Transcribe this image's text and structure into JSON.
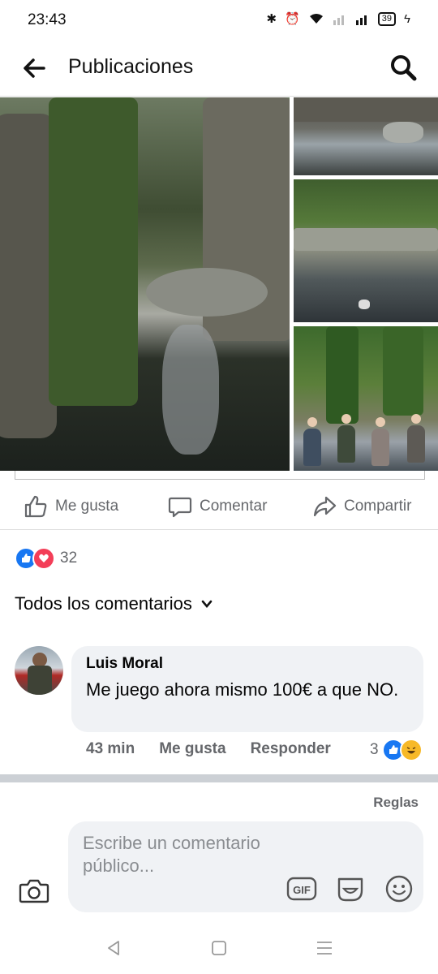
{
  "status_bar": {
    "time": "23:43",
    "battery": "39"
  },
  "header": {
    "title": "Publicaciones"
  },
  "actions": {
    "like": "Me gusta",
    "comment": "Comentar",
    "share": "Compartir"
  },
  "reactions": {
    "count": "32",
    "types": [
      "like-icon",
      "love-icon"
    ]
  },
  "comments_filter": {
    "label": "Todos los comentarios"
  },
  "comment": {
    "author": "Luis Moral",
    "text": "Me juego ahora mismo 100€ a que NO.",
    "time": "43 min",
    "like": "Me gusta",
    "reply": "Responder",
    "reaction_count": "3",
    "reaction_types": [
      "like-icon",
      "haha-icon"
    ]
  },
  "rules": "Reglas",
  "composer": {
    "placeholder": "Escribe un comentario público..."
  },
  "colors": {
    "fb_blue": "#1877f2",
    "love_red": "#f33e58",
    "haha_yellow": "#f7b928",
    "gray": "#65676b"
  }
}
